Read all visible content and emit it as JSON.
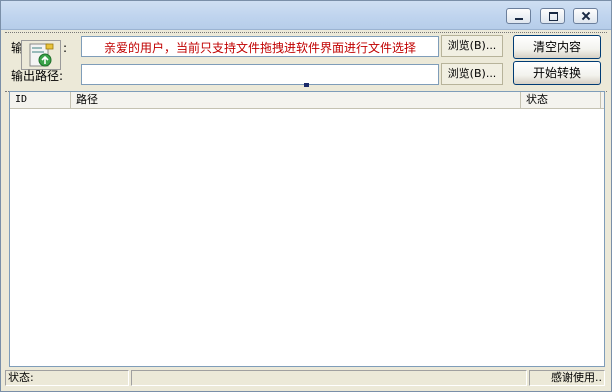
{
  "window": {
    "controls": {
      "minimize_icon": "minimize-icon",
      "maximize_icon": "maximize-icon",
      "close_icon": "close-icon"
    }
  },
  "form": {
    "input_label": "输入",
    "input_label_colon": ":",
    "input_value": "亲爱的用户，当前只支持文件拖拽进软件界面进行文件选择",
    "output_label": "输出路径:",
    "output_value": "",
    "browse_label": "浏览(B)...",
    "clear_button": "清空内容",
    "convert_button": "开始转换",
    "drag_icon": "file-add-icon"
  },
  "list": {
    "columns": [
      "ID",
      "路径",
      "状态"
    ],
    "rows": []
  },
  "statusbar": {
    "left": "状态:",
    "middle": "",
    "right": "感谢使用.."
  },
  "colors": {
    "accent_text": "#c00000",
    "window_bg": "#ece9d8"
  }
}
